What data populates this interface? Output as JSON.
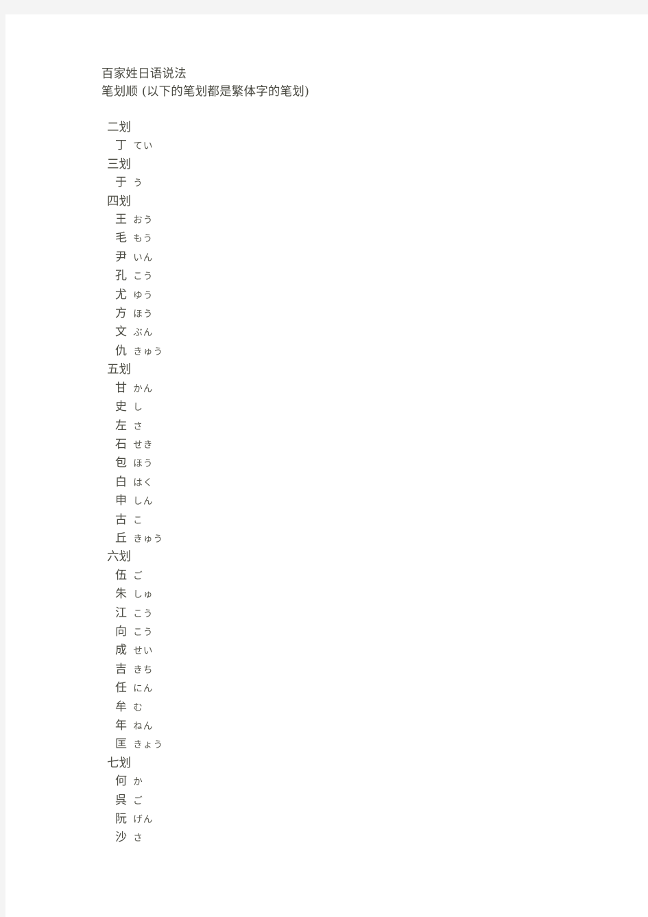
{
  "document": {
    "title": "百家姓日语说法",
    "subtitle": "笔划顺 (以下的笔划都是繁体字的笔划)",
    "sections": [
      {
        "heading": "二划",
        "entries": [
          {
            "kanji": "丁",
            "kana": "てい"
          }
        ]
      },
      {
        "heading": "三划",
        "entries": [
          {
            "kanji": "于",
            "kana": "う"
          }
        ]
      },
      {
        "heading": "四划",
        "entries": [
          {
            "kanji": "王",
            "kana": "おう"
          },
          {
            "kanji": "毛",
            "kana": "もう"
          },
          {
            "kanji": "尹",
            "kana": "いん"
          },
          {
            "kanji": "孔",
            "kana": "こう"
          },
          {
            "kanji": "尤",
            "kana": "ゆう"
          },
          {
            "kanji": "方",
            "kana": "ほう"
          },
          {
            "kanji": "文",
            "kana": "ぶん"
          },
          {
            "kanji": "仇",
            "kana": "きゅう"
          }
        ]
      },
      {
        "heading": "五划",
        "entries": [
          {
            "kanji": "甘",
            "kana": "かん"
          },
          {
            "kanji": "史",
            "kana": "し"
          },
          {
            "kanji": "左",
            "kana": "さ"
          },
          {
            "kanji": "石",
            "kana": "せき"
          },
          {
            "kanji": "包",
            "kana": "ほう"
          },
          {
            "kanji": "白",
            "kana": "はく"
          },
          {
            "kanji": "申",
            "kana": "しん"
          },
          {
            "kanji": "古",
            "kana": "こ"
          },
          {
            "kanji": "丘",
            "kana": "きゅう"
          }
        ]
      },
      {
        "heading": "六划",
        "entries": [
          {
            "kanji": "伍",
            "kana": "ご"
          },
          {
            "kanji": "朱",
            "kana": "しゅ"
          },
          {
            "kanji": "江",
            "kana": "こう"
          },
          {
            "kanji": "向",
            "kana": "こう"
          },
          {
            "kanji": "成",
            "kana": "せい"
          },
          {
            "kanji": "吉",
            "kana": "きち"
          },
          {
            "kanji": "任",
            "kana": "にん"
          },
          {
            "kanji": "牟",
            "kana": "む"
          },
          {
            "kanji": "年",
            "kana": "ねん"
          },
          {
            "kanji": "匡",
            "kana": "きょう"
          }
        ]
      },
      {
        "heading": "七划",
        "entries": [
          {
            "kanji": "何",
            "kana": "か"
          },
          {
            "kanji": "呉",
            "kana": "ご"
          },
          {
            "kanji": "阮",
            "kana": "げん"
          },
          {
            "kanji": "沙",
            "kana": "さ"
          }
        ]
      }
    ]
  },
  "colors": {
    "page_background": "#ffffff",
    "canvas_background": "#f4f4f4",
    "text": "#4a4a42"
  }
}
